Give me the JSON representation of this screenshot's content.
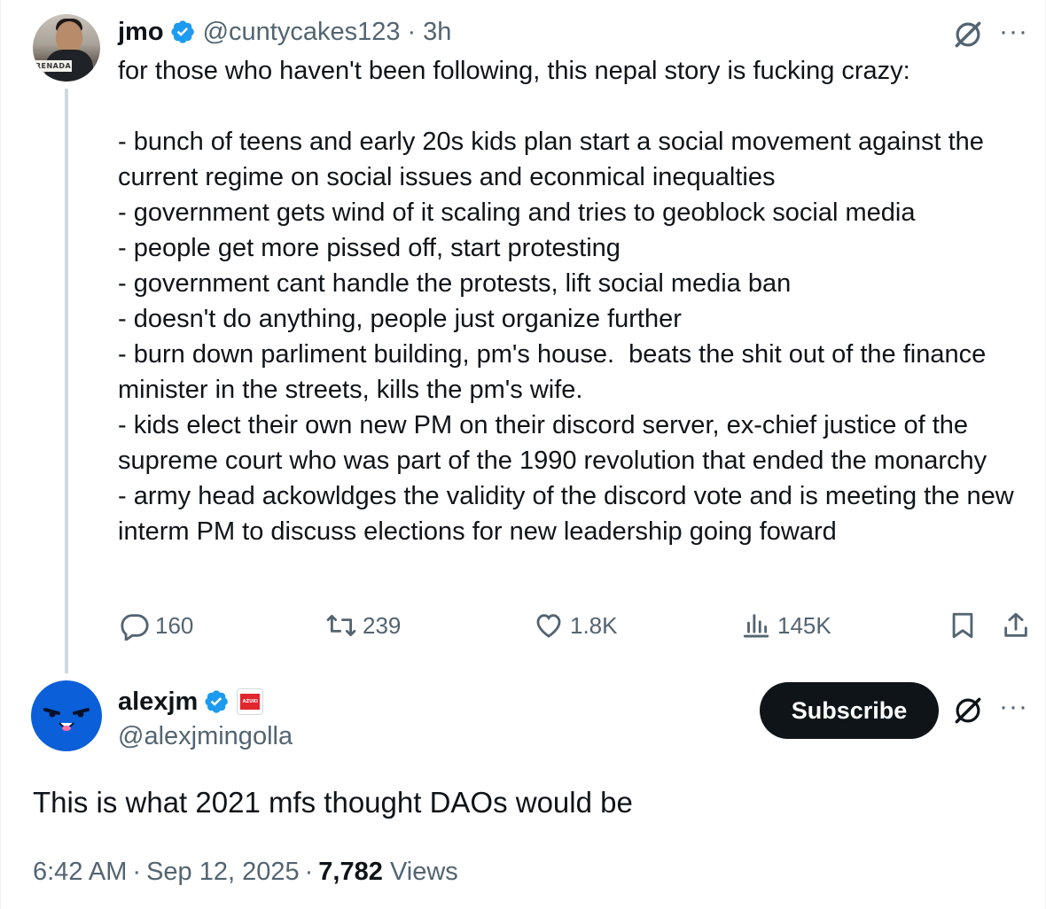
{
  "parent_tweet": {
    "author_name": "jmo",
    "handle": "@cuntycakes123",
    "separator": "·",
    "time_ago": "3h",
    "avatar_plate_text": "RENADA",
    "more_label": "···",
    "text": "for those who haven't been following, this nepal story is fucking crazy:\n\n- bunch of teens and early 20s kids plan start a social movement against the current regime on social issues and econmical inequalties\n- government gets wind of it scaling and tries to geoblock social media\n- people get more pissed off, start protesting\n- government cant handle the protests, lift social media ban\n- doesn't do anything, people just organize further\n- burn down parliment building, pm's house.  beats the shit out of the finance minister in the streets, kills the pm's wife.\n- kids elect their own new PM on their discord server, ex-chief justice of the supreme court who was part of the 1990 revolution that ended the monarchy\n- army head ackowldges the validity of the discord vote and is meeting the new interm PM to discuss elections for new leadership going foward",
    "stats": {
      "replies": "160",
      "reposts": "239",
      "likes": "1.8K",
      "views": "145K"
    }
  },
  "reply_tweet": {
    "author_name": "alexjm",
    "handle": "@alexjmingolla",
    "affiliate_badge_text": "AZUKI",
    "subscribe_label": "Subscribe",
    "more_label": "···",
    "text": "This is what 2021 mfs thought DAOs would be",
    "time": "6:42 AM",
    "sep1": "·",
    "date": "Sep 12, 2025",
    "sep2": "·",
    "views_count": "7,782",
    "views_label": "Views"
  },
  "colors": {
    "text_primary": "#0f1419",
    "text_secondary": "#536471",
    "verified_blue": "#1d9bf0",
    "thread_line": "#cfd9de",
    "subscribe_bg": "#0f1419",
    "avatar_blue": "#0b5fd9",
    "badge_red": "#e0262f"
  },
  "icons": [
    "verified-badge-icon",
    "grok-icon",
    "more-icon",
    "reply-icon",
    "repost-icon",
    "like-icon",
    "views-icon",
    "bookmark-icon",
    "share-icon"
  ]
}
